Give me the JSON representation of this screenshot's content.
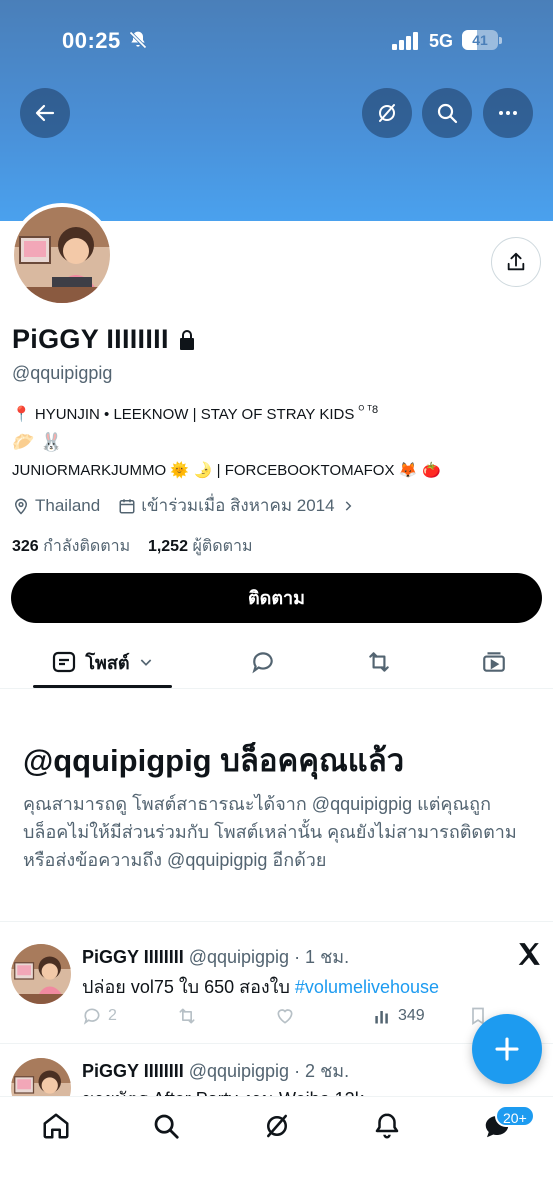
{
  "status_bar": {
    "time": "00:25",
    "network": "5G",
    "battery": "41",
    "battery_level": 0.41
  },
  "header": {
    "back_icon": "arrow-left-icon",
    "grok_icon": "grok-icon",
    "search_icon": "search-icon",
    "more_icon": "more-horizontal-icon"
  },
  "profile": {
    "display_name": "PiGGY IIIIIIII",
    "handle": "@qquipigpig",
    "bio_line1": "HYUNJIN • LEEKNOW | STAY OF STRAY KIDS",
    "bio_line1_sup": "ᴼ ᵀ8",
    "bio_line2_emoji": "🥟 🐰",
    "bio_line3_a": "JUNIORMARKJUMMO",
    "bio_line3_emoji": "🌞 🌛",
    "bio_line3_b": "| FORCEBOOKTOMAFOX",
    "bio_line3_emoji2": "🦊 🍅",
    "pin_emoji": "📍",
    "location": "Thailand",
    "joined": "เข้าร่วมเมื่อ สิงหาคม 2014",
    "following_count": "326",
    "following_label": "กำลังติดตาม",
    "followers_count": "1,252",
    "followers_label": "ผู้ติดตาม",
    "follow_button": "ติดตาม"
  },
  "tabs": {
    "posts_label": "โพสต์"
  },
  "blocked": {
    "title": "@qquipigpig บล็อคคุณแล้ว",
    "text": "คุณสามารถดู โพสต์สาธารณะได้จาก @qquipigpig แต่คุณถูกบล็อคไม่ให้มีส่วนร่วมกับ โพสต์เหล่านั้น คุณยังไม่สามารถติดตามหรือส่งข้อความถึง @qquipigpig อีกด้วย"
  },
  "tweets": [
    {
      "name": "PiGGY IIIIIIII",
      "handle_time": "@qquipigpig · 1 ชม.",
      "text": "ปล่อย vol75 ใบ 650 สองใบ",
      "hashtag": "#volumelivehouse",
      "replies": "2",
      "views": "349"
    },
    {
      "name": "PiGGY IIIIIIII",
      "handle_time": "@qquipigpig · 2 ชม.",
      "text": "ขายบัตร After Party งาน Weibo 12k"
    }
  ],
  "nav": {
    "badge": "20+"
  },
  "colors": {
    "accent": "#1d9bf0",
    "banner": "#4a8fd6",
    "text": "#0f1419",
    "muted": "#536471"
  }
}
